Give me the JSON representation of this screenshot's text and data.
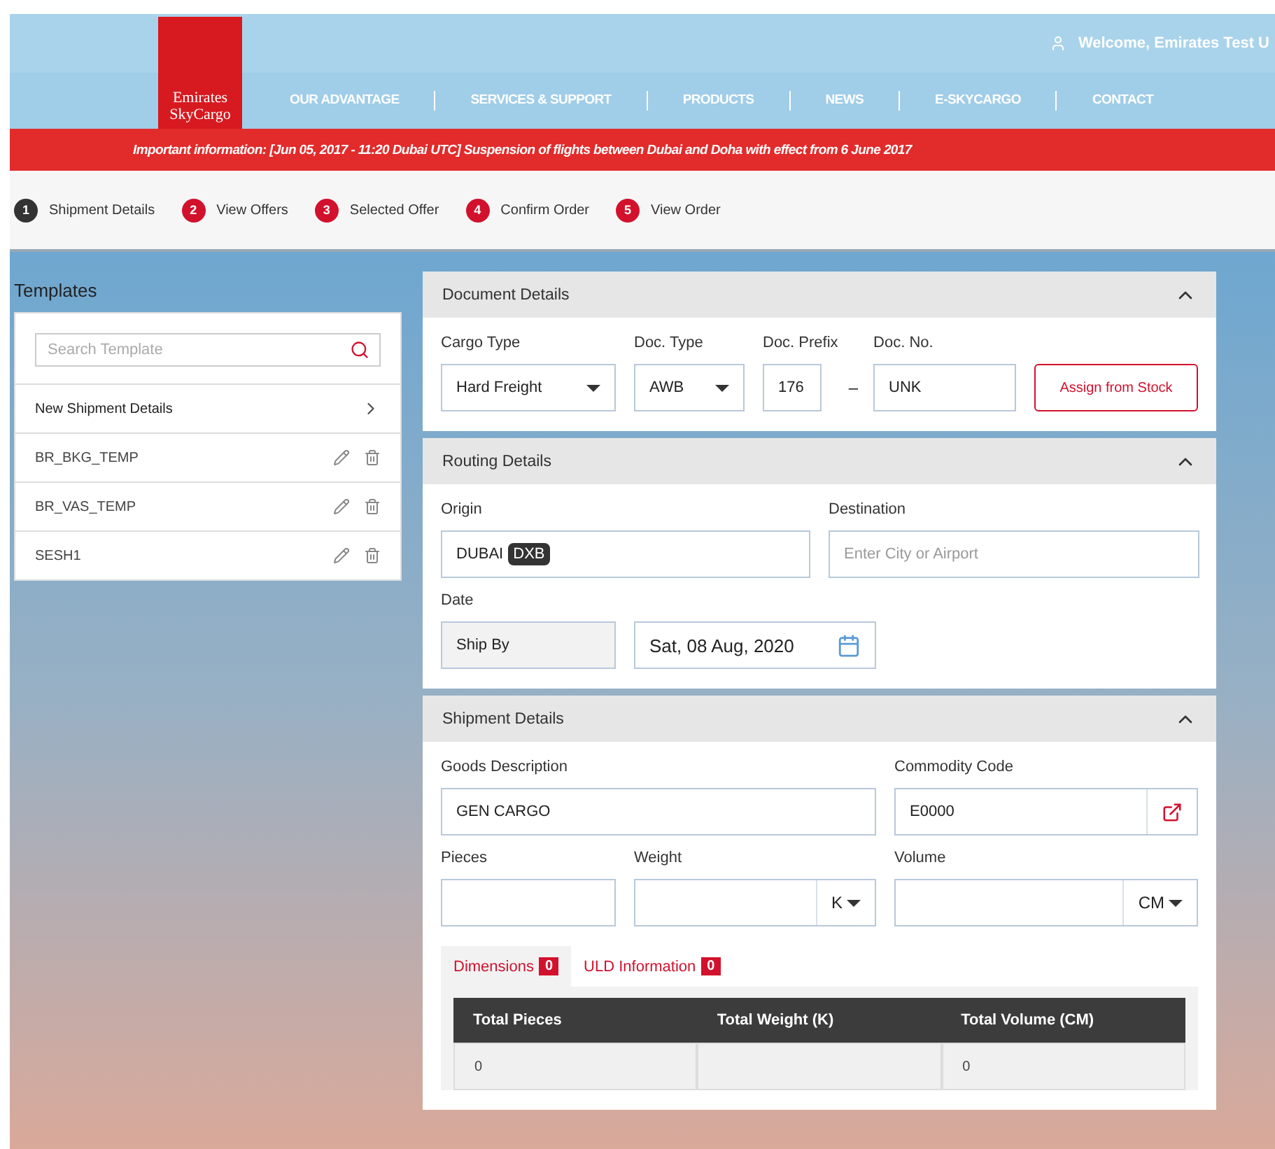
{
  "header": {
    "logo_lines": [
      "Emirates",
      "SkyCargo"
    ],
    "welcome": "Welcome,  Emirates Test U"
  },
  "nav": [
    "OUR ADVANTAGE",
    "SERVICES & SUPPORT",
    "PRODUCTS",
    "NEWS",
    "E-SKYCARGO",
    "CONTACT"
  ],
  "notice": "Important information: [Jun 05, 2017 - 11:20 Dubai UTC] Suspension of flights between Dubai and Doha with effect from 6 June 2017",
  "steps": [
    {
      "number": "1",
      "label": "Shipment Details",
      "selected": true
    },
    {
      "number": "2",
      "label": "View Offers",
      "selected": false
    },
    {
      "number": "3",
      "label": "Selected Offer",
      "selected": false
    },
    {
      "number": "4",
      "label": "Confirm Order",
      "selected": false
    },
    {
      "number": "5",
      "label": "View Order",
      "selected": false
    }
  ],
  "templates": {
    "title": "Templates",
    "search": {
      "placeholder": "Search Template"
    },
    "new_item": "New Shipment Details",
    "items": [
      "BR_BKG_TEMP",
      "BR_VAS_TEMP",
      "SESH1"
    ]
  },
  "document_details": {
    "title": "Document Details",
    "cargo_type": {
      "label": "Cargo Type",
      "value": "Hard Freight"
    },
    "doc_type": {
      "label": "Doc. Type",
      "value": "AWB"
    },
    "doc_prefix": {
      "label": "Doc. Prefix",
      "value": "176"
    },
    "separator": "–",
    "doc_no": {
      "label": "Doc. No.",
      "value": "UNK"
    },
    "assign_button": "Assign from Stock"
  },
  "routing_details": {
    "title": "Routing Details",
    "origin": {
      "label": "Origin",
      "value": "DUBAI",
      "code": "DXB"
    },
    "destination": {
      "label": "Destination",
      "placeholder": "Enter City or Airport"
    },
    "date": {
      "label": "Date",
      "mode": "Ship By",
      "value": "Sat, 08 Aug, 2020"
    }
  },
  "shipment_details": {
    "title": "Shipment Details",
    "goods_description": {
      "label": "Goods Description",
      "value": "GEN CARGO"
    },
    "commodity_code": {
      "label": "Commodity Code",
      "value": "E0000"
    },
    "pieces": {
      "label": "Pieces"
    },
    "weight": {
      "label": "Weight",
      "unit": "K"
    },
    "volume": {
      "label": "Volume",
      "unit": "CM"
    },
    "tabs": [
      {
        "label": "Dimensions",
        "count": "0",
        "selected": true
      },
      {
        "label": "ULD Information",
        "count": "0",
        "selected": false
      }
    ],
    "table": {
      "columns": [
        "Total Pieces",
        "Total Weight (K)",
        "Total Volume (CM)"
      ],
      "rows": [
        [
          "0",
          "",
          "0"
        ]
      ]
    }
  }
}
